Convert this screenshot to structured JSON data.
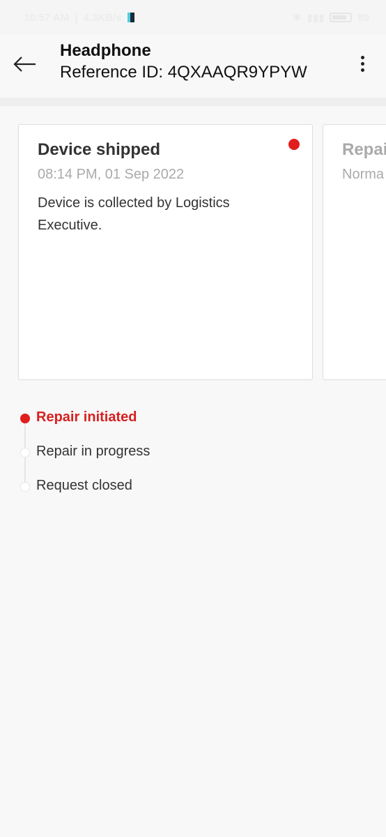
{
  "status_bar": {
    "time": "10:57 AM",
    "network_speed": "4.3KB/s",
    "battery": "89"
  },
  "header": {
    "title": "Headphone",
    "reference": "Reference ID: 4QXAAQR9YPYW"
  },
  "cards": [
    {
      "title": "Device shipped",
      "date": "08:14 PM, 01 Sep 2022",
      "description": "Device is collected by Logistics Executive."
    },
    {
      "title": "Repai",
      "date": "Norma",
      "description": ""
    }
  ],
  "timeline": {
    "steps": [
      {
        "label": "Repair initiated",
        "active": true
      },
      {
        "label": "Repair in progress",
        "active": false
      },
      {
        "label": "Request closed",
        "active": false
      }
    ]
  },
  "colors": {
    "accent": "#e11d1d",
    "background": "#f8f8f8",
    "muted": "#aaaaaa"
  }
}
